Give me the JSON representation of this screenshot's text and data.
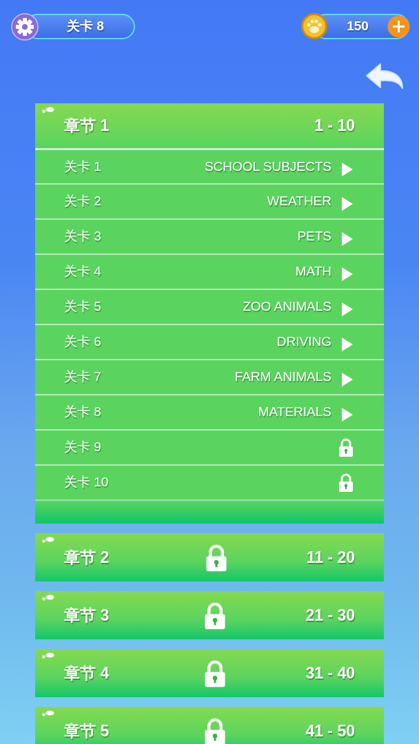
{
  "level_badge": {
    "label": "关卡 8"
  },
  "coins": {
    "amount": "150"
  },
  "chapters": [
    {
      "title": "章节 1",
      "range": "1 - 10",
      "locked": false,
      "expanded": true,
      "levels": [
        {
          "label": "关卡 1",
          "topic": "SCHOOL SUBJECTS",
          "locked": false
        },
        {
          "label": "关卡 2",
          "topic": "WEATHER",
          "locked": false
        },
        {
          "label": "关卡 3",
          "topic": "PETS",
          "locked": false
        },
        {
          "label": "关卡 4",
          "topic": "MATH",
          "locked": false
        },
        {
          "label": "关卡 5",
          "topic": "ZOO ANIMALS",
          "locked": false
        },
        {
          "label": "关卡 6",
          "topic": "DRIVING",
          "locked": false
        },
        {
          "label": "关卡 7",
          "topic": "FARM ANIMALS",
          "locked": false
        },
        {
          "label": "关卡 8",
          "topic": "MATERIALS",
          "locked": false
        },
        {
          "label": "关卡 9",
          "locked": true
        },
        {
          "label": "关卡 10",
          "locked": true
        }
      ]
    },
    {
      "title": "章节 2",
      "range": "11 - 20",
      "locked": true,
      "expanded": false
    },
    {
      "title": "章节 3",
      "range": "21 - 30",
      "locked": true,
      "expanded": false
    },
    {
      "title": "章节 4",
      "range": "31 - 40",
      "locked": true,
      "expanded": false
    },
    {
      "title": "章节 5",
      "range": "41 - 50",
      "locked": true,
      "expanded": false
    }
  ]
}
